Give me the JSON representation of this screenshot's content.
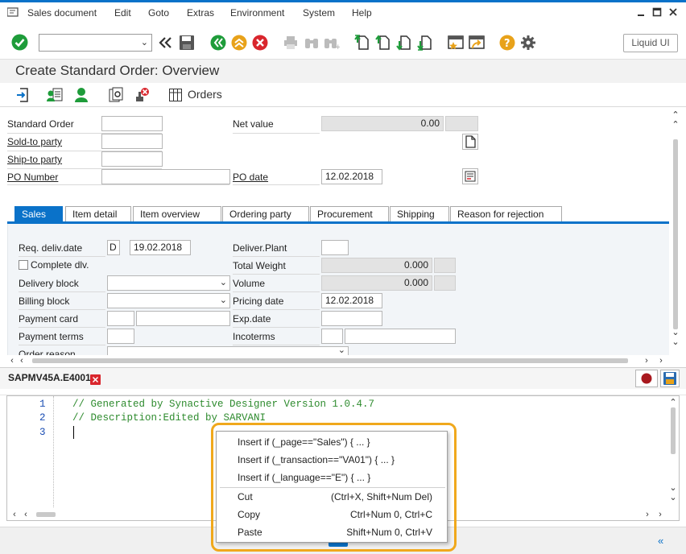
{
  "menubar": {
    "items": [
      "Sales document",
      "Edit",
      "Goto",
      "Extras",
      "Environment",
      "System",
      "Help"
    ]
  },
  "toolbar": {
    "command_field_value": "",
    "liquid_ui_label": "Liquid UI"
  },
  "title": "Create Standard Order: Overview",
  "app_toolbar": {
    "orders_label": "Orders"
  },
  "header": {
    "standard_order_label": "Standard Order",
    "standard_order_value": "",
    "sold_to_label": "Sold-to party",
    "sold_to_value": "",
    "ship_to_label": "Ship-to party",
    "ship_to_value": "",
    "po_number_label": "PO Number",
    "po_number_value": "",
    "net_value_label": "Net value",
    "net_value_value": "0.00",
    "net_value_currency": "",
    "po_date_label": "PO date",
    "po_date_value": "12.02.2018"
  },
  "tabs": [
    "Sales",
    "Item detail",
    "Item overview",
    "Ordering party",
    "Procurement",
    "Shipping",
    "Reason for rejection"
  ],
  "sales_tab": {
    "req_deliv_date_label": "Req. deliv.date",
    "req_deliv_date_format": "D",
    "req_deliv_date_value": "19.02.2018",
    "complete_dlv_label": "Complete dlv.",
    "delivery_block_label": "Delivery block",
    "delivery_block_value": "",
    "billing_block_label": "Billing block",
    "billing_block_value": "",
    "payment_card_label": "Payment card",
    "payment_card_type": "",
    "payment_card_number": "",
    "payment_terms_label": "Payment terms",
    "payment_terms_value": "",
    "order_reason_label": "Order reason",
    "order_reason_value": "",
    "deliver_plant_label": "Deliver.Plant",
    "deliver_plant_value": "",
    "total_weight_label": "Total Weight",
    "total_weight_value": "0.000",
    "total_weight_unit": "",
    "volume_label": "Volume",
    "volume_value": "0.000",
    "volume_unit": "",
    "pricing_date_label": "Pricing date",
    "pricing_date_value": "12.02.2018",
    "exp_date_label": "Exp.date",
    "exp_date_value": "",
    "incoterms_label": "Incoterms",
    "incoterms_code": "",
    "incoterms_text": ""
  },
  "script_editor": {
    "tab_title": "SAPMV45A.E4001",
    "lines": [
      {
        "num": "1",
        "text": "// Generated by Synactive Designer Version 1.0.4.7"
      },
      {
        "num": "2",
        "text": "// Description:Edited by SARVANI"
      },
      {
        "num": "3",
        "text": ""
      }
    ]
  },
  "context_menu": {
    "items": [
      {
        "label": "Insert if (_page==\"Sales\") { ... }",
        "shortcut": ""
      },
      {
        "label": "Insert if (_transaction==\"VA01\") { ... }",
        "shortcut": ""
      },
      {
        "label": "Insert if (_language==\"E\") { ... }",
        "shortcut": ""
      },
      {
        "label": "Cut",
        "shortcut": "(Ctrl+X, Shift+Num Del)"
      },
      {
        "label": "Copy",
        "shortcut": "Ctrl+Num 0, Ctrl+C"
      },
      {
        "label": "Paste",
        "shortcut": "Shift+Num 0, Ctrl+V"
      }
    ]
  },
  "colors": {
    "accent_blue": "#0a72c9",
    "highlight_orange": "#f0a81c",
    "code_green": "#2e8b2e",
    "check_green": "#1e9c3a",
    "cancel_red": "#d9262d"
  }
}
